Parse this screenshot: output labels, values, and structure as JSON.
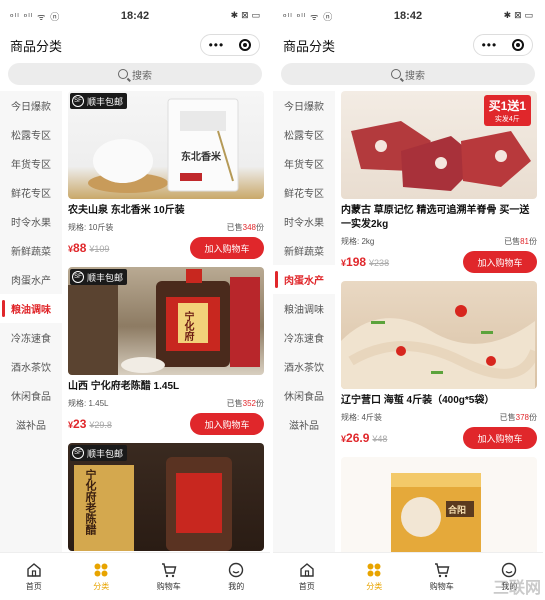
{
  "status": {
    "signal": "ᵒˡˡ ᵒˡˡ ᯤ ⓝ",
    "time": "18:42",
    "right": "✱ ⊠ ▭"
  },
  "topbar": {
    "title": "商品分类"
  },
  "search": {
    "placeholder": "搜索"
  },
  "sidebar": {
    "items": [
      "今日爆款",
      "松露专区",
      "年货专区",
      "鲜花专区",
      "时令水果",
      "新鲜蔬菜",
      "肉蛋水产",
      "粮油调味",
      "冷冻速食",
      "酒水茶饮",
      "休闲食品",
      "滋补品"
    ]
  },
  "left": {
    "active_index": 7,
    "products": [
      {
        "badge": "顺丰包邮",
        "name": "农夫山泉 东北香米 10斤装",
        "spec": "规格: 10斤装",
        "sold_prefix": "已售",
        "sold": "348",
        "sold_suffix": "份",
        "price": "88",
        "orig": "¥109",
        "btn": "加入购物车",
        "img_text": "东北香米"
      },
      {
        "badge": "顺丰包邮",
        "name": "山西 宁化府老陈醋 1.45L",
        "spec": "规格: 1.45L",
        "sold_prefix": "已售",
        "sold": "352",
        "sold_suffix": "份",
        "price": "23",
        "orig": "¥29.8",
        "btn": "加入购物车",
        "img_text": "宁化府"
      },
      {
        "badge": "顺丰包邮",
        "img_text": "宁化府老陈醋"
      }
    ]
  },
  "right": {
    "active_index": 6,
    "products": [
      {
        "promo": "买1送1",
        "promo_sub": "实发4斤",
        "name": "内蒙古 草原记忆 精选可追溯羊脊骨 买一送一实发2kg",
        "spec": "规格: 2kg",
        "sold_prefix": "已售",
        "sold": "81",
        "sold_suffix": "份",
        "price": "198",
        "orig": "¥238",
        "btn": "加入购物车"
      },
      {
        "name": "辽宁营口 海蜇 4斤装（400g*5袋）",
        "spec": "规格: 4斤装",
        "sold_prefix": "已售",
        "sold": "378",
        "sold_suffix": "份",
        "price": "26.9",
        "orig": "¥48",
        "btn": "加入购物车"
      },
      {
        "img_text": "合阳"
      }
    ]
  },
  "tabs": [
    {
      "label": "首页",
      "icon": "home-icon"
    },
    {
      "label": "分类",
      "icon": "category-icon"
    },
    {
      "label": "购物车",
      "icon": "cart-icon"
    },
    {
      "label": "我的",
      "icon": "profile-icon"
    }
  ],
  "currency": "¥",
  "watermark": "三联网",
  "colors": {
    "accent": "#e0272b",
    "tab_active": "#e8a400"
  }
}
